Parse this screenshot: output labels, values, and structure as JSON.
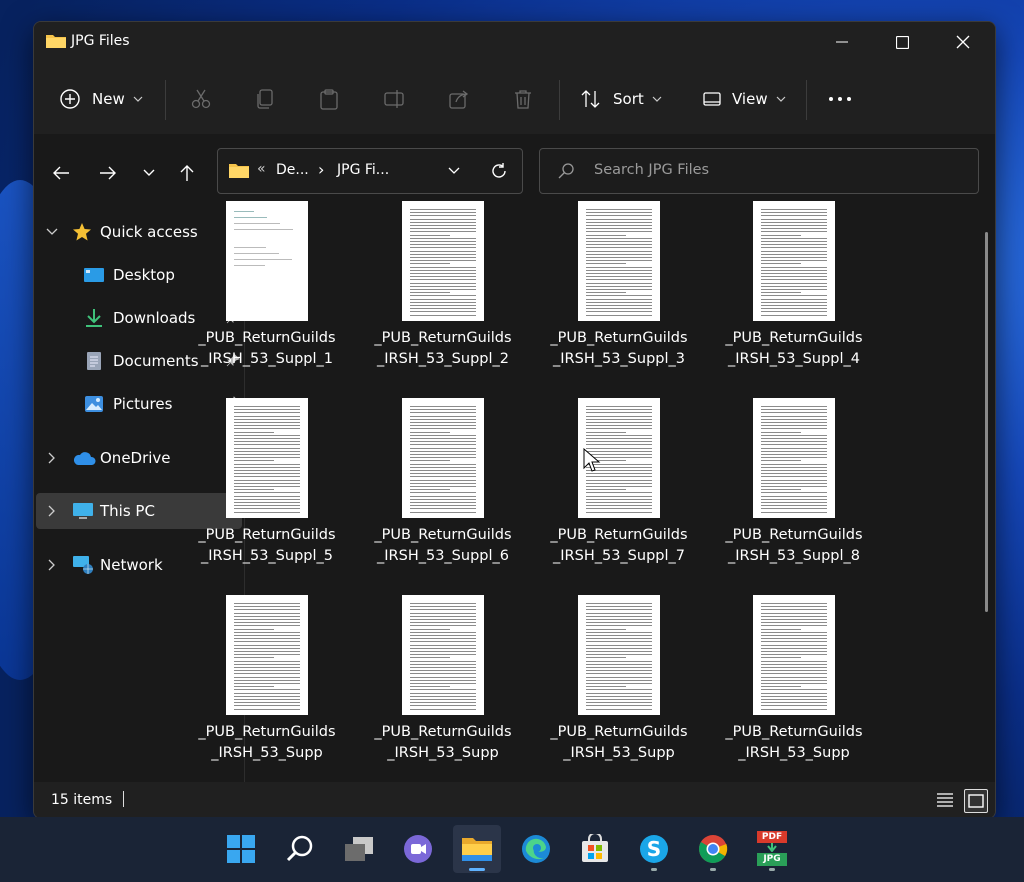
{
  "window": {
    "title": "JPG Files",
    "minimize_label": "",
    "maximize_label": "",
    "close_label": ""
  },
  "toolbar": {
    "new_label": "New",
    "sort_label": "Sort",
    "view_label": "View",
    "icons": [
      "new-icon",
      "cut-icon",
      "copy-icon",
      "paste-icon",
      "rename-icon",
      "share-icon",
      "delete-icon",
      "sort-icon",
      "view-icon",
      "more-icon"
    ]
  },
  "address": {
    "path_prefix": "«",
    "crumb_1": "De...",
    "crumb_sep": "›",
    "crumb_2": "JPG Fi...",
    "search_placeholder": "Search JPG Files"
  },
  "nav": {
    "quick_access": "Quick access",
    "desktop": "Desktop",
    "downloads": "Downloads",
    "documents": "Documents",
    "pictures": "Pictures",
    "onedrive": "OneDrive",
    "this_pc": "This PC",
    "network": "Network"
  },
  "files": [
    {
      "name": "_PUB_ReturnGuilds_IRSH_53_Suppl_1"
    },
    {
      "name": "_PUB_ReturnGuilds_IRSH_53_Suppl_2"
    },
    {
      "name": "_PUB_ReturnGuilds_IRSH_53_Suppl_3"
    },
    {
      "name": "_PUB_ReturnGuilds_IRSH_53_Suppl_4"
    },
    {
      "name": "_PUB_ReturnGuilds_IRSH_53_Suppl_5"
    },
    {
      "name": "_PUB_ReturnGuilds_IRSH_53_Suppl_6"
    },
    {
      "name": "_PUB_ReturnGuilds_IRSH_53_Suppl_7"
    },
    {
      "name": "_PUB_ReturnGuilds_IRSH_53_Suppl_8"
    },
    {
      "name": "_PUB_ReturnGuilds_IRSH_53_Supp"
    },
    {
      "name": "_PUB_ReturnGuilds_IRSH_53_Supp"
    },
    {
      "name": "_PUB_ReturnGuilds_IRSH_53_Supp"
    },
    {
      "name": "_PUB_ReturnGuilds_IRSH_53_Supp"
    }
  ],
  "status": {
    "items": "15 items"
  },
  "taskbar": {
    "apps": [
      "start-icon",
      "search-icon",
      "task-view-icon",
      "teams-chat-icon",
      "file-explorer-icon",
      "edge-icon",
      "store-icon",
      "skype-icon",
      "chrome-icon",
      "pdf-to-jpg-icon"
    ],
    "pdf_label": "PDF",
    "jpg_label": "JPG"
  },
  "colors": {
    "window_bg": "#202020",
    "content_bg": "#191919",
    "accent": "#5fb2ff",
    "folder": "#f5c34a"
  }
}
